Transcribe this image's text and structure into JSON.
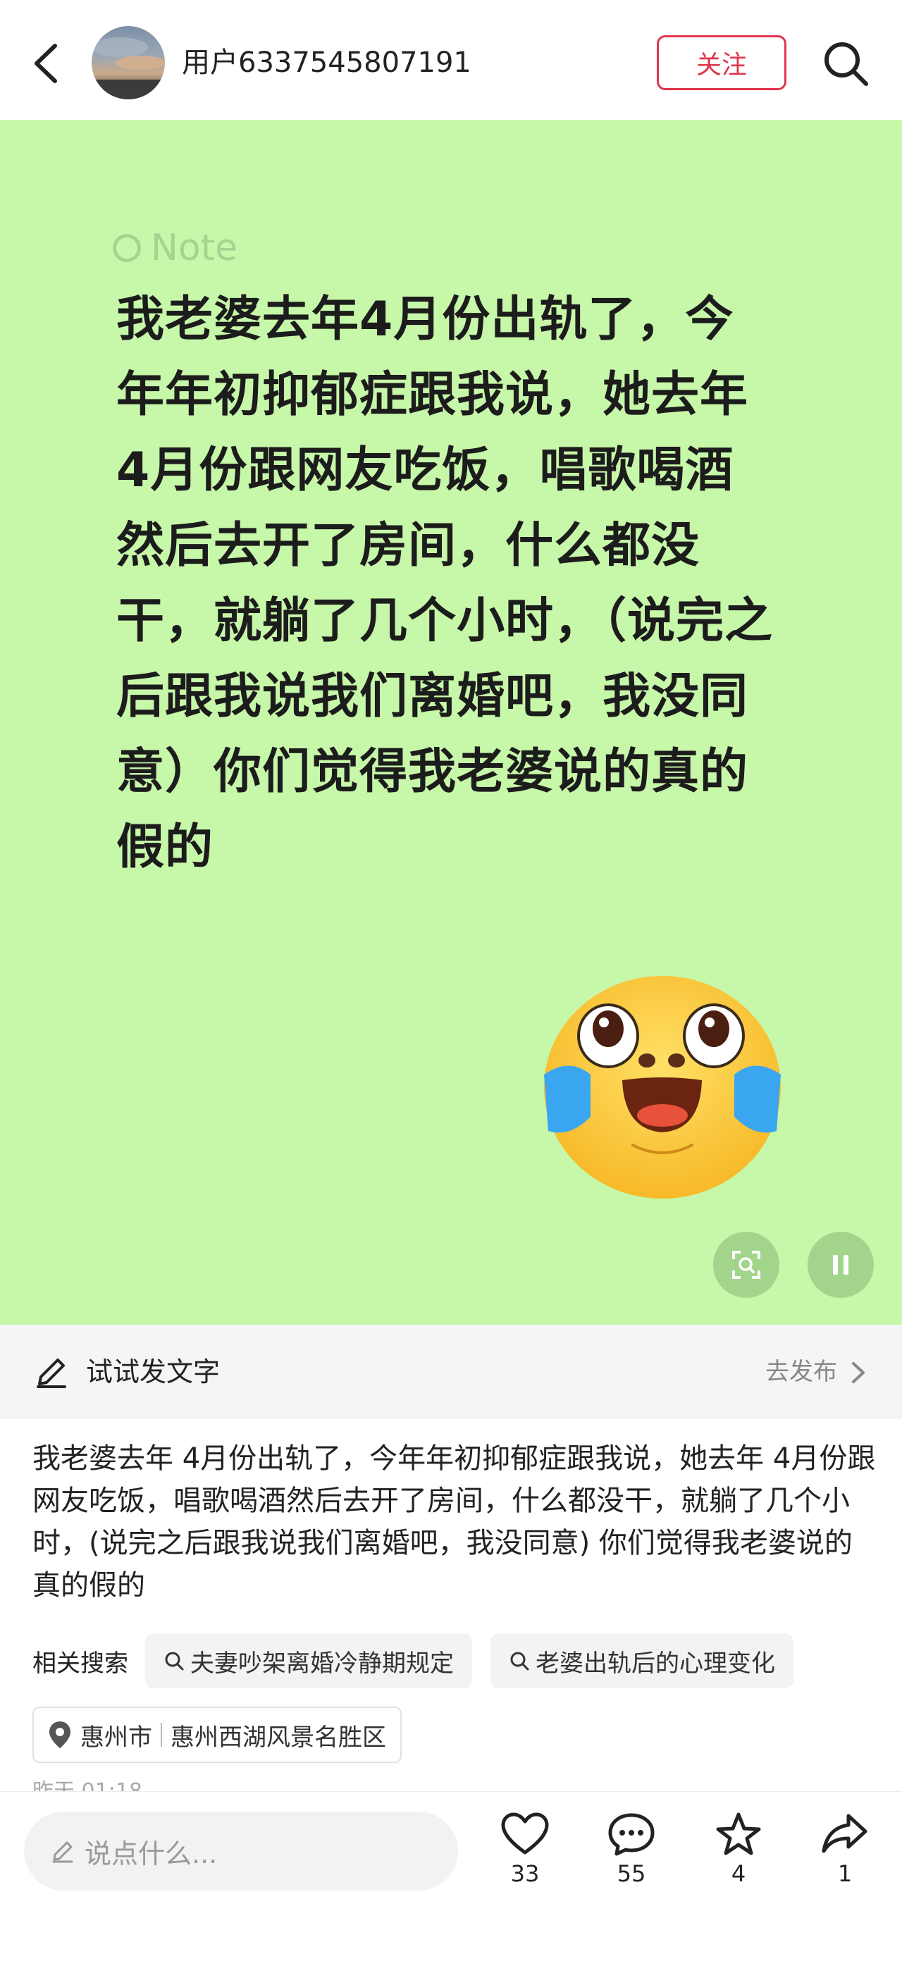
{
  "header": {
    "username": "用户6337545807191",
    "follow_label": "关注"
  },
  "note": {
    "brand": "Note",
    "text": "我老婆去年4月份出轨了，今年年初抑郁症跟我说，她去年4月份跟网友吃饭，唱歌喝酒然后去开了房间，什么都没干，就躺了几个小时，（说完之后跟我说我们离婚吧，我没同意）你们觉得我老婆说的真的假的"
  },
  "compose": {
    "label": "试试发文字",
    "publish": "去发布"
  },
  "description": "我老婆去年 4月份出轨了，今年年初抑郁症跟我说，她去年 4月份跟网友吃饭，唱歌喝酒然后去开了房间，什么都没干，就躺了几个小时，(说完之后跟我说我们离婚吧，我没同意) 你们觉得我老婆说的真的假的",
  "related": {
    "title": "相关搜索",
    "chips": [
      "夫妻吵架离婚冷静期规定",
      "老婆出轨后的心理变化"
    ]
  },
  "location": {
    "city": "惠州市",
    "place": "惠州西湖风景名胜区"
  },
  "timestamp": "昨天 01:18",
  "bottom": {
    "comment_placeholder": "说点什么...",
    "likes": "33",
    "comments": "55",
    "favorites": "4",
    "shares": "1"
  },
  "colors": {
    "note_background": "#c7f7a9",
    "accent": "#e0364c"
  },
  "icons": [
    "back-arrow-icon",
    "search-icon",
    "scan-icon",
    "pause-icon",
    "pen-icon",
    "chevron-right-icon",
    "location-pin-icon",
    "heart-icon",
    "comment-icon",
    "star-icon",
    "share-icon",
    "crying-face-emoji"
  ]
}
